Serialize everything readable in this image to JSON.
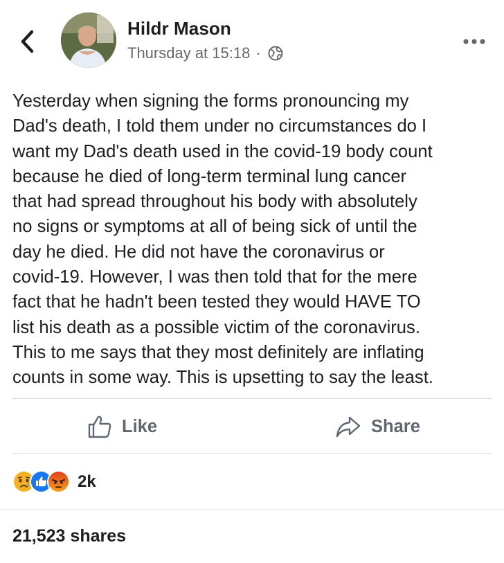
{
  "post": {
    "author": "Hildr Mason",
    "timestamp": "Thursday at 15:18",
    "separator": "·",
    "audience_icon": "globe-icon",
    "text": "Yesterday when signing the forms pronouncing my\nDad's death, I told them under no circumstances do I\nwant my Dad's death used in the covid-19 body count\nbecause he died of long-term terminal lung cancer\nthat had spread throughout his body with absolutely\nno signs or symptoms at all of being sick of until the\nday he died. He did not have the coronavirus or\ncovid-19. However, I was then told that for the mere\nfact that he hadn't been tested they would HAVE TO\nlist his death as a possible victim of the coronavirus.\nThis to me says that they most definitely are inflating\ncounts in some way. This is upsetting to say the least."
  },
  "actions": {
    "like_label": "Like",
    "share_label": "Share"
  },
  "reactions": {
    "icons": [
      "sad-icon",
      "like-icon",
      "angry-icon"
    ],
    "count": "2k"
  },
  "shares": {
    "label": "21,523 shares"
  },
  "colors": {
    "like_blue": "#1877f2",
    "sad_yellow": "#f7b125",
    "angry_orange": "#e9710f",
    "secondary_text": "#65676b"
  }
}
